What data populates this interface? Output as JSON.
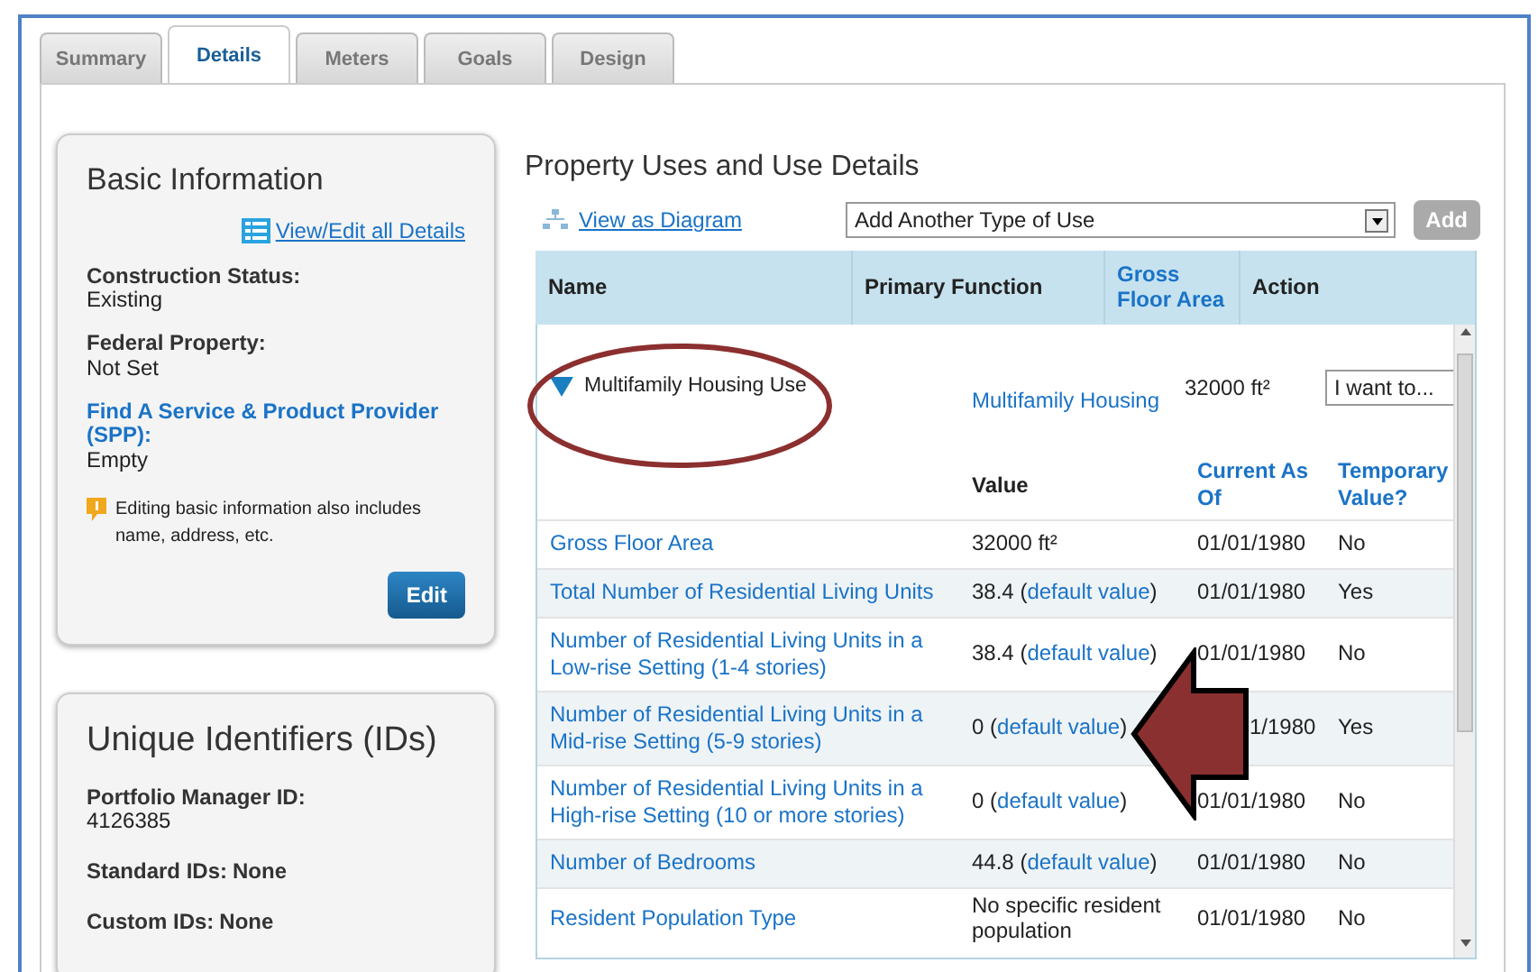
{
  "tabs": [
    {
      "label": "Summary",
      "selected": false
    },
    {
      "label": "Details",
      "selected": true
    },
    {
      "label": "Meters",
      "selected": false
    },
    {
      "label": "Goals",
      "selected": false
    },
    {
      "label": "Design",
      "selected": false
    }
  ],
  "basic_info": {
    "title": "Basic Information",
    "link": "View/Edit all Details",
    "fields": [
      {
        "kind": "plain",
        "label": "Construction Status:",
        "value": "Existing"
      },
      {
        "kind": "plain",
        "label": "Federal Property:",
        "value": "Not Set"
      },
      {
        "kind": "link",
        "label": "Find A Service & Product Provider (SPP):",
        "value": "Empty"
      }
    ],
    "note": "Editing basic information also includes name, address, etc.",
    "button": "Edit"
  },
  "identifiers": {
    "title": "Unique Identifiers (IDs)",
    "fields": [
      {
        "kind": "stacked",
        "label": "Portfolio Manager ID:",
        "value": "4126385"
      },
      {
        "kind": "inline",
        "label": "Standard IDs:",
        "value": "None"
      },
      {
        "kind": "inline",
        "label": "Custom IDs:",
        "value": "None"
      }
    ]
  },
  "uses": {
    "title": "Property Uses and Use Details",
    "diagram_link": "View as Diagram",
    "add_select": "Add Another Type of Use",
    "add_button": {
      "label": "Add",
      "disabled": true
    },
    "columns": [
      {
        "label": "Name",
        "link": false
      },
      {
        "label": "Primary Function",
        "link": false
      },
      {
        "label": "Gross Floor Area",
        "link": true
      },
      {
        "label": "Action",
        "link": false
      }
    ],
    "use": {
      "name": "Multifamily Housing Use",
      "expanded": true,
      "function": "Multifamily Housing",
      "area": "32000 ft²",
      "action": "I want to..."
    },
    "detail_columns": [
      {
        "label": "Value",
        "link": false
      },
      {
        "label": "Current As Of",
        "link": true
      },
      {
        "label": "Temporary Value?",
        "link": true
      }
    ],
    "details": [
      {
        "label": "Gross Floor Area",
        "value": "32000 ft²",
        "current": "01/01/1980",
        "covered": false,
        "temporary": "No"
      },
      {
        "label": "Total Number of Residential Living Units",
        "value": "38.4 (",
        "value_link": "default value",
        "value_end": ")",
        "current": "01/01/1980",
        "covered": false,
        "temporary": "Yes"
      },
      {
        "label": "Number of Residential Living Units in a Low-rise Setting (1-4 stories)",
        "value": "38.4 (",
        "value_link": "default value",
        "value_end": ")",
        "current": "01/01/1980",
        "covered": false,
        "temporary": "No"
      },
      {
        "label": "Number of Residential Living Units in a Mid-rise Setting (5-9 stories)",
        "value": "0 (",
        "value_link": "default value",
        "value_end": ")",
        "current": "1/1980",
        "covered": true,
        "temporary": "Yes"
      },
      {
        "label": "Number of Residential Living Units in a High-rise Setting (10 or more stories)",
        "value": "0 (",
        "value_link": "default value",
        "value_end": ")",
        "current": "01/01/1980",
        "covered": false,
        "temporary": "No"
      },
      {
        "label": "Number of Bedrooms",
        "value": "44.8 (",
        "value_link": "default value",
        "value_end": ")",
        "current": "01/01/1980",
        "covered": false,
        "temporary": "No"
      },
      {
        "label": "Resident Population Type",
        "value": "No specific resident population",
        "current": "01/01/1980",
        "covered": false,
        "temporary": "No"
      }
    ]
  }
}
